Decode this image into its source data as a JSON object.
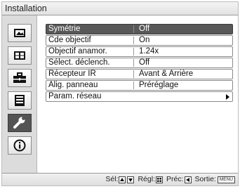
{
  "header": {
    "title": "Installation"
  },
  "sidebar": {
    "items": [
      {
        "name": "picture-icon",
        "active": false
      },
      {
        "name": "screen-icon",
        "active": false
      },
      {
        "name": "briefcase-icon",
        "active": false
      },
      {
        "name": "list-icon",
        "active": false
      },
      {
        "name": "wrench-icon",
        "active": true
      },
      {
        "name": "info-icon",
        "active": false
      }
    ]
  },
  "menu": {
    "rows": [
      {
        "label": "Symétrie",
        "value": "Off",
        "selected": true
      },
      {
        "label": "Cde objectif",
        "value": "On",
        "selected": false
      },
      {
        "label": "Objectif anamor.",
        "value": "1.24x",
        "selected": false
      },
      {
        "label": "Sélect. déclench.",
        "value": "Off",
        "selected": false
      },
      {
        "label": "Récepteur IR",
        "value": "Avant & Arrière",
        "selected": false
      },
      {
        "label": "Alig. panneau",
        "value": "Préréglage",
        "selected": false
      },
      {
        "label": "Param. réseau",
        "value": "",
        "submenu": true,
        "selected": false
      }
    ]
  },
  "footer": {
    "sel": "Sél:",
    "regl": "Régl:",
    "prec": "Préc:",
    "sortie": "Sortie:",
    "menu_key": "MENU"
  }
}
